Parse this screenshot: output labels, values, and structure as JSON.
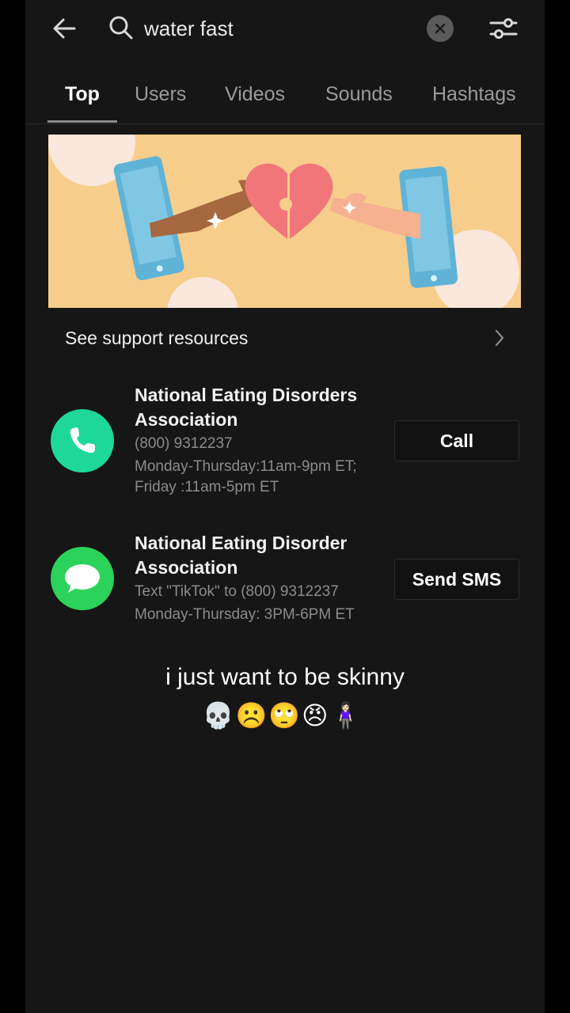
{
  "search": {
    "query": "water fast"
  },
  "tabs": [
    {
      "label": "Top"
    },
    {
      "label": "Users"
    },
    {
      "label": "Videos"
    },
    {
      "label": "Sounds"
    },
    {
      "label": "Hashtags"
    }
  ],
  "support": {
    "label": "See support resources"
  },
  "contacts": [
    {
      "title_line1": "National Eating Disorders",
      "title_line2": "Association",
      "detail1": "(800) 9312237",
      "detail2": "Monday-Thursday:11am-9pm ET;",
      "detail3": "Friday :11am-5pm ET",
      "button": "Call"
    },
    {
      "title_line1": "National Eating Disorder",
      "title_line2": "Association",
      "detail1": "Text \"TikTok\" to (800) 9312237",
      "detail2": "Monday-Thursday: 3PM-6PM ET",
      "button": "Send SMS"
    }
  ],
  "overlay": {
    "caption": "i just want to be skinny",
    "emojis": "💀☹️🙄😠🧍🏻‍♀️"
  },
  "colors": {
    "call_green": "#1ed89a",
    "sms_green": "#2bd35b",
    "banner_bg": "#f7cd8b"
  },
  "icons": [
    "back-arrow-icon",
    "search-icon",
    "clear-icon",
    "filter-icon",
    "chevron-right-icon",
    "phone-icon",
    "message-icon"
  ]
}
